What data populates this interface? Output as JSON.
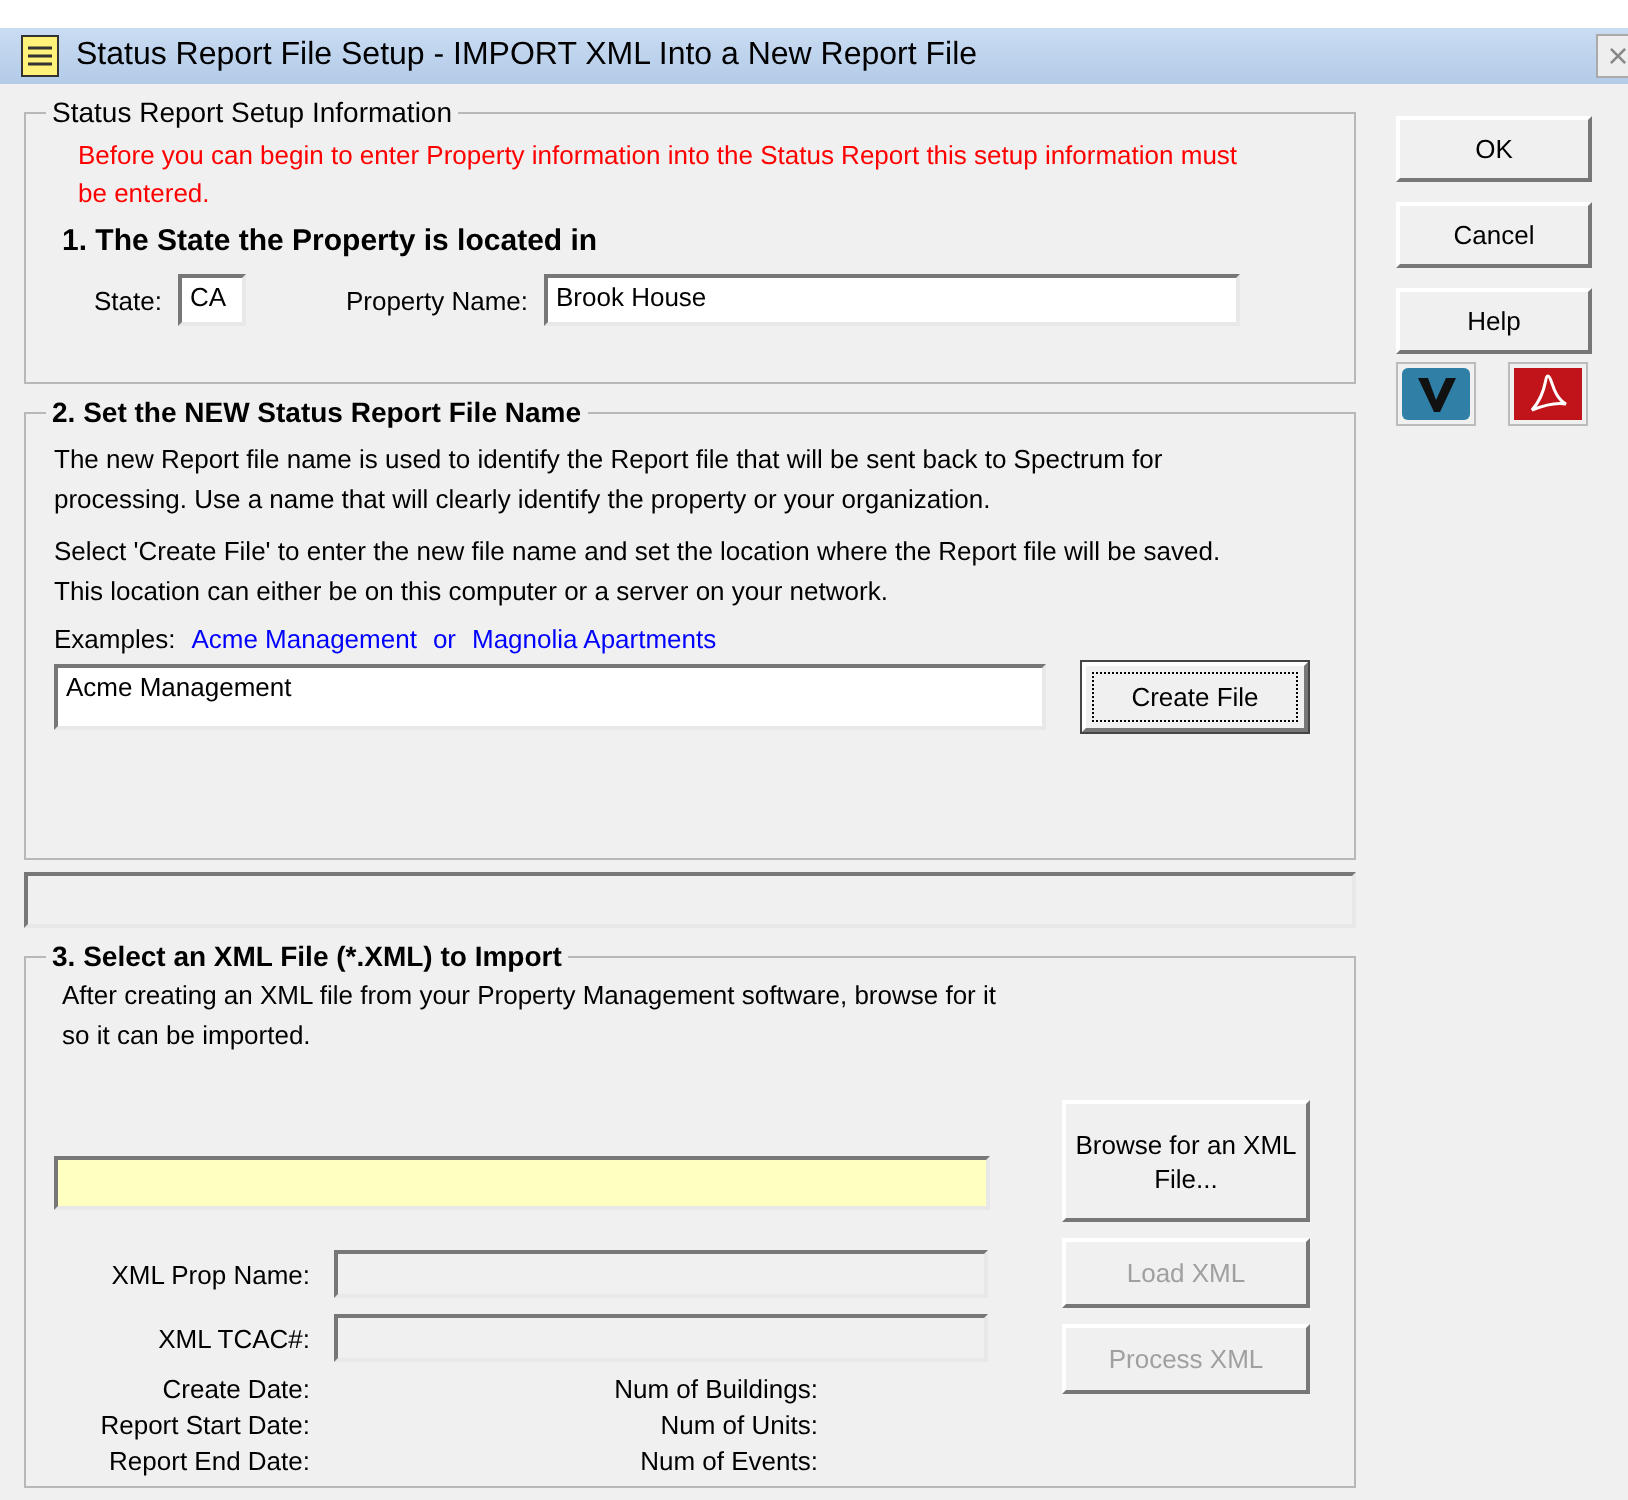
{
  "window": {
    "title": "Status Report File Setup - IMPORT XML Into a New Report File",
    "close": "×"
  },
  "setup": {
    "legend": "Status Report Setup Information",
    "warning": "Before you can begin to enter Property information into the Status Report this setup information must be entered.",
    "heading": "1. The State the Property is located in",
    "state": {
      "label": "State:",
      "value": "CA"
    },
    "property_name": {
      "label": "Property Name:",
      "value": "Brook House"
    }
  },
  "file_name": {
    "legend": "2. Set the NEW Status Report File Name",
    "paragraphs": [
      "The new Report file name is used to identify the Report file that will be sent back to Spectrum for processing. Use a name that will clearly identify the property or your organization.",
      "Select 'Create File' to enter the new file name and set the location where the Report file will be saved. This location can either be on this computer or a server on your network."
    ],
    "examples_label": "Examples:",
    "examples": [
      "Acme Management",
      "or",
      "Magnolia Apartments"
    ],
    "value": "Acme Management",
    "button": {
      "label": "Create File",
      "disabled": false,
      "focused": true
    }
  },
  "xml": {
    "legend": "3.  Select an XML File (*.XML) to Import",
    "description": "After creating an XML file from your Property Management software, browse for it so it can be imported.",
    "fields": [
      {
        "label": "XML Prop Name:"
      },
      {
        "label": "XML TCAC#:"
      }
    ],
    "info_left": [
      "Create Date:",
      "Report Start Date:",
      "Report End Date:"
    ],
    "info_right": [
      "Num of Buildings:",
      "Num of Units:",
      "Num of Events:"
    ],
    "buttons": [
      {
        "label": "Browse for an XML File...",
        "disabled": false
      },
      {
        "label": "Load XML",
        "disabled": true
      },
      {
        "label": "Process XML",
        "disabled": true
      }
    ]
  },
  "side_buttons": [
    {
      "label": "OK",
      "disabled": false
    },
    {
      "label": "Cancel",
      "disabled": false
    },
    {
      "label": "Help",
      "disabled": false
    }
  ]
}
